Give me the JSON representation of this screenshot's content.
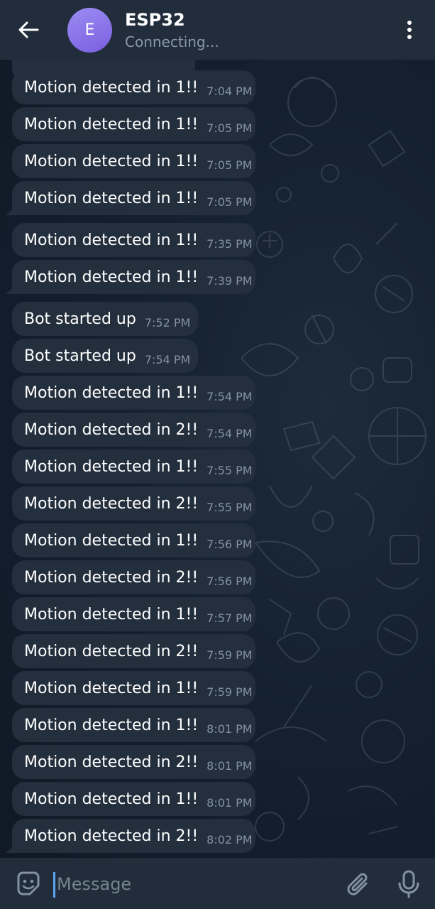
{
  "header": {
    "back_icon": "arrow-left-icon",
    "avatar_letter": "E",
    "avatar_gradient": [
      "#9b8cf2",
      "#7b5fe0"
    ],
    "title": "ESP32",
    "status": "Connecting...",
    "menu_icon": "more-vertical-icon"
  },
  "messages": [
    {
      "text": "Motion detected in 1!!",
      "time": "7:04 PM"
    },
    {
      "text": "Motion detected in 1!!",
      "time": "7:05 PM"
    },
    {
      "text": "Motion detected in 1!!",
      "time": "7:05 PM"
    },
    {
      "text": "Motion detected in 1!!",
      "time": "7:05 PM"
    },
    {
      "text": "Motion detected in 1!!",
      "time": "7:35 PM"
    },
    {
      "text": "Motion detected in 1!!",
      "time": "7:39 PM"
    },
    {
      "text": "Bot started up",
      "time": "7:52 PM"
    },
    {
      "text": "Bot started up",
      "time": "7:54 PM"
    },
    {
      "text": "Motion detected in 1!!",
      "time": "7:54 PM"
    },
    {
      "text": "Motion detected in 2!!",
      "time": "7:54 PM"
    },
    {
      "text": "Motion detected in 1!!",
      "time": "7:55 PM"
    },
    {
      "text": "Motion detected in 2!!",
      "time": "7:55 PM"
    },
    {
      "text": "Motion detected in 1!!",
      "time": "7:56 PM"
    },
    {
      "text": "Motion detected in 2!!",
      "time": "7:56 PM"
    },
    {
      "text": "Motion detected in 1!!",
      "time": "7:57 PM"
    },
    {
      "text": "Motion detected in 2!!",
      "time": "7:59 PM"
    },
    {
      "text": "Motion detected in 1!!",
      "time": "7:59 PM"
    },
    {
      "text": "Motion detected in 1!!",
      "time": "8:01 PM"
    },
    {
      "text": "Motion detected in 2!!",
      "time": "8:01 PM"
    },
    {
      "text": "Motion detected in 1!!",
      "time": "8:01 PM"
    },
    {
      "text": "Motion detected in 2!!",
      "time": "8:02 PM"
    }
  ],
  "composer": {
    "placeholder": "Message",
    "emoji_icon": "sticker-emoji-icon",
    "attach_icon": "paperclip-icon",
    "mic_icon": "microphone-icon"
  },
  "colors": {
    "header_bg": "#212d3b",
    "bubble_bg": "#232f3d",
    "time_text": "#8391a1",
    "accent": "#5ea4f0"
  }
}
